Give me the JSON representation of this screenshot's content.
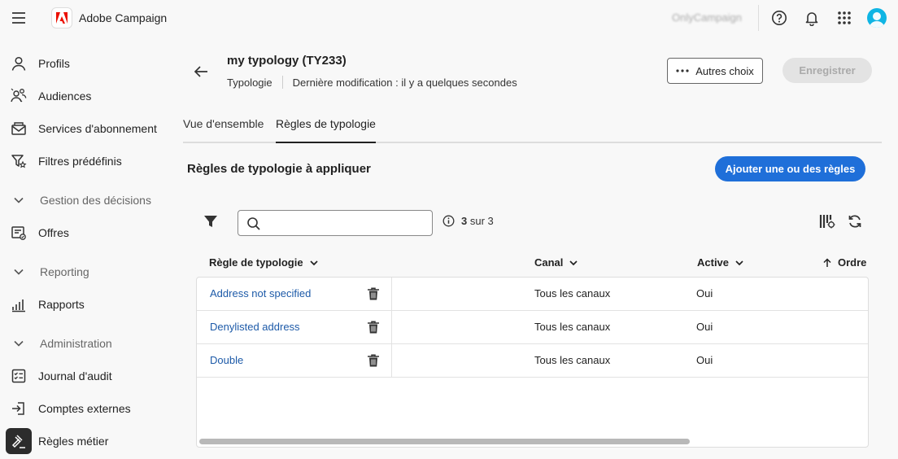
{
  "app": {
    "name": "Adobe Campaign",
    "org": "OnlyCampaign"
  },
  "sidebar": {
    "profils": "Profils",
    "audiences": "Audiences",
    "services": "Services d'abonnement",
    "filtres": "Filtres prédéfinis",
    "section_decisions": "Gestion des décisions",
    "offres": "Offres",
    "section_reporting": "Reporting",
    "rapports": "Rapports",
    "section_admin": "Administration",
    "journal": "Journal d'audit",
    "comptes": "Comptes externes",
    "regles": "Règles métier"
  },
  "header": {
    "title": "my typology (TY233)",
    "type": "Typologie",
    "modified": "Dernière modification : il y a quelques secondes",
    "more_label": "Autres choix",
    "save_label": "Enregistrer"
  },
  "tabs": {
    "overview": "Vue d'ensemble",
    "rules": "Règles de typologie"
  },
  "section": {
    "title": "Règles de typologie à appliquer",
    "add_label": "Ajouter une ou des règles"
  },
  "toolbar": {
    "search_value": "",
    "count_bold": "3",
    "count_rest": "sur 3"
  },
  "table": {
    "col_rule": "Règle de typologie",
    "col_canal": "Canal",
    "col_active": "Active",
    "col_order": "Ordre",
    "rows": [
      {
        "name": "Address not specified",
        "canal": "Tous les canaux",
        "active": "Oui"
      },
      {
        "name": "Denylisted address",
        "canal": "Tous les canaux",
        "active": "Oui"
      },
      {
        "name": "Double",
        "canal": "Tous les canaux",
        "active": "Oui"
      }
    ]
  },
  "colors": {
    "accent": "#1f6fd9",
    "link": "#1d5aa8",
    "adobe_red": "#eb1000",
    "avatar": "#0fb5e4"
  }
}
